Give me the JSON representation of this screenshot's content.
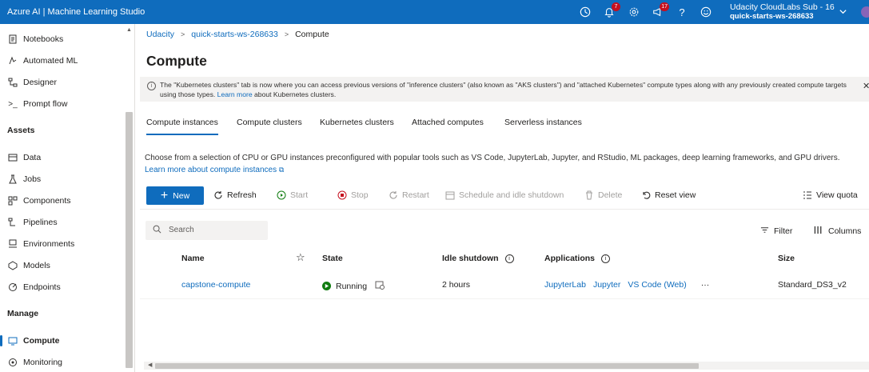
{
  "topbar": {
    "brand": "Azure AI | Machine Learning Studio",
    "notifications_count": "7",
    "feedback_count": "17",
    "account_name": "Udacity CloudLabs Sub - 16",
    "workspace": "quick-starts-ws-268633"
  },
  "sidebar": {
    "items_top": [
      {
        "label": "Notebooks",
        "icon": "notebook-icon"
      },
      {
        "label": "Automated ML",
        "icon": "automated-ml-icon"
      },
      {
        "label": "Designer",
        "icon": "designer-icon"
      },
      {
        "label": "Prompt flow",
        "icon": "prompt-flow-icon"
      }
    ],
    "assets_header": "Assets",
    "assets": [
      {
        "label": "Data",
        "icon": "data-icon"
      },
      {
        "label": "Jobs",
        "icon": "jobs-icon"
      },
      {
        "label": "Components",
        "icon": "components-icon"
      },
      {
        "label": "Pipelines",
        "icon": "pipelines-icon"
      },
      {
        "label": "Environments",
        "icon": "environments-icon"
      },
      {
        "label": "Models",
        "icon": "models-icon"
      },
      {
        "label": "Endpoints",
        "icon": "endpoints-icon"
      }
    ],
    "manage_header": "Manage",
    "manage": [
      {
        "label": "Compute",
        "icon": "compute-icon",
        "active": true
      },
      {
        "label": "Monitoring",
        "icon": "monitoring-icon"
      }
    ]
  },
  "breadcrumb": [
    "Udacity",
    "quick-starts-ws-268633",
    "Compute"
  ],
  "page_title": "Compute",
  "info_banner": {
    "text": "The \"Kubernetes clusters\" tab is now where you can access previous versions of \"inference clusters\" (also known as \"AKS clusters\") and \"attached Kubernetes\" compute types along with any previously created compute targets using those types.",
    "link": "Learn more",
    "link_suffix": "about Kubernetes clusters."
  },
  "tabs": [
    "Compute instances",
    "Compute clusters",
    "Kubernetes clusters",
    "Attached computes",
    "Serverless instances"
  ],
  "description": "Choose from a selection of CPU or GPU instances preconfigured with popular tools such as VS Code, JupyterLab, Jupyter, and RStudio, ML packages, deep learning frameworks, and GPU drivers.",
  "learn_more": "Learn more about compute instances",
  "toolbar": {
    "new": "New",
    "refresh": "Refresh",
    "start": "Start",
    "stop": "Stop",
    "restart": "Restart",
    "schedule": "Schedule and idle shutdown",
    "delete": "Delete",
    "reset_view": "Reset view",
    "view_quota": "View quota"
  },
  "search": {
    "placeholder": "Search"
  },
  "filter": "Filter",
  "columns": "Columns",
  "table": {
    "headers": {
      "name": "Name",
      "state": "State",
      "idle": "Idle shutdown",
      "apps": "Applications",
      "size": "Size"
    },
    "rows": [
      {
        "name": "capstone-compute",
        "state": "Running",
        "idle": "2 hours",
        "apps": [
          "JupyterLab",
          "Jupyter",
          "VS Code (Web)"
        ],
        "more": "···",
        "size": "Standard_DS3_v2"
      }
    ]
  },
  "colors": {
    "accent": "#0f6cbd",
    "running": "#107c10",
    "badge": "#c50f1f"
  }
}
